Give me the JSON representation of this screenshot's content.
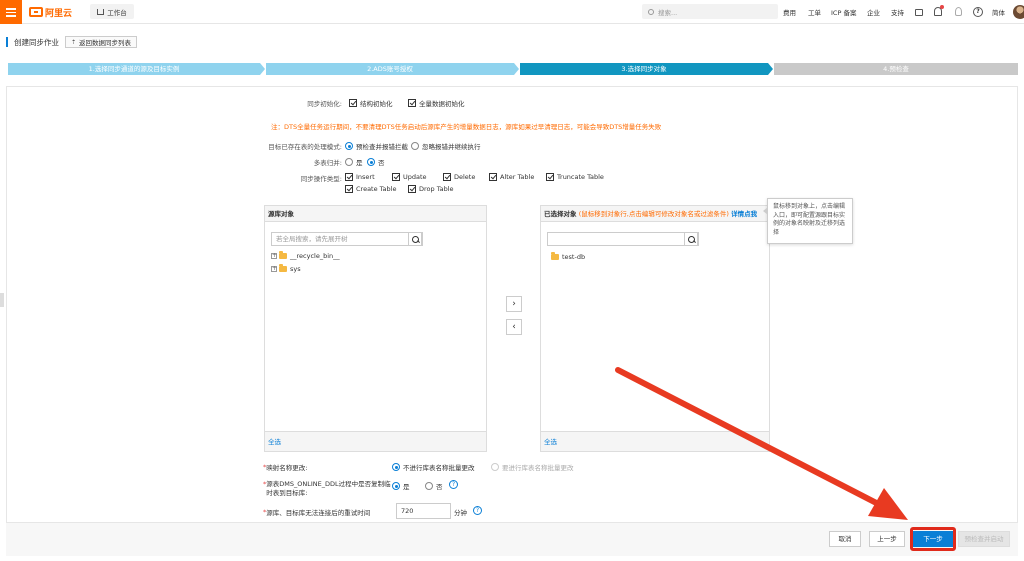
{
  "topbar": {
    "logo_text": "阿里云",
    "workspace_label": "工作台",
    "search_placeholder": "搜索...",
    "nav": [
      "费用",
      "工单",
      "ICP 备案",
      "企业",
      "支持"
    ],
    "lang": "简体"
  },
  "page": {
    "title": "创建同步作业",
    "back_button": "返回数据同步列表"
  },
  "steps": [
    {
      "label": "1.选择同步通道的源及目标实例",
      "state": "done"
    },
    {
      "label": "2.ADS账号授权",
      "state": "done"
    },
    {
      "label": "3.选择同步对象",
      "state": "active"
    },
    {
      "label": "4.预检查",
      "state": "todo"
    }
  ],
  "colors": {
    "accent": "#0a7fd6",
    "step_done": "#8fd3ee",
    "step_active": "#1196c0",
    "step_todo": "#c9c9c9",
    "brand": "#ff6a00",
    "warning": "#ff6a00",
    "arrow": "#e83a21"
  },
  "form": {
    "sync_init": {
      "label": "同步初始化:",
      "options": [
        "结构初始化",
        "全量数据初始化"
      ]
    },
    "warning": "注：DTS全量任务运行期间，不要清理DTS任务启动后源库产生的增量数据日志，源库如果过早清理日志，可能会导致DTS增量任务失败",
    "target_exists": {
      "label": "目标已存在表的处理模式:",
      "options": [
        "预检查并报错拦截",
        "忽略报错并继续执行"
      ]
    },
    "multi_table_merge": {
      "label": "多表归并:",
      "options": [
        "是",
        "否"
      ]
    },
    "op_types": {
      "label": "同步操作类型:",
      "options": [
        "Insert",
        "Update",
        "Delete",
        "Alter Table",
        "Truncate Table",
        "Create Table",
        "Drop Table"
      ]
    },
    "source_box": {
      "header": "源库对象",
      "search_placeholder": "若全局搜索，请先展开树",
      "items": [
        "__recycle_bin__",
        "sys"
      ],
      "select_all": "全选"
    },
    "selected_box": {
      "header": "已选择对象",
      "hint": "(鼠标移到对象行,点击编辑可修改对象名或过滤条件)",
      "details_link": "详情点我",
      "items": [
        "test-db"
      ],
      "select_all": "全选"
    },
    "tooltip": "鼠标移到对象上，点击编辑入口，即可配置源跟目标实例的对象名映射及迁移列选择",
    "mapping_rename": {
      "label": "映射名称更改:",
      "options": [
        "不进行库表名称批量更改",
        "要进行库表名称批量更改"
      ]
    },
    "dms_ddl": {
      "label": "源表DMS_ONLINE_DDL过程中是否复制临时表到目标库:",
      "options": [
        "是",
        "否"
      ]
    },
    "retry_time": {
      "label": "源库、目标库无法连接后的重试时间",
      "value": "720",
      "unit": "分钟"
    }
  },
  "footer": {
    "cancel": "取消",
    "prev": "上一步",
    "next": "下一步",
    "precheck": "预检查并启动"
  }
}
